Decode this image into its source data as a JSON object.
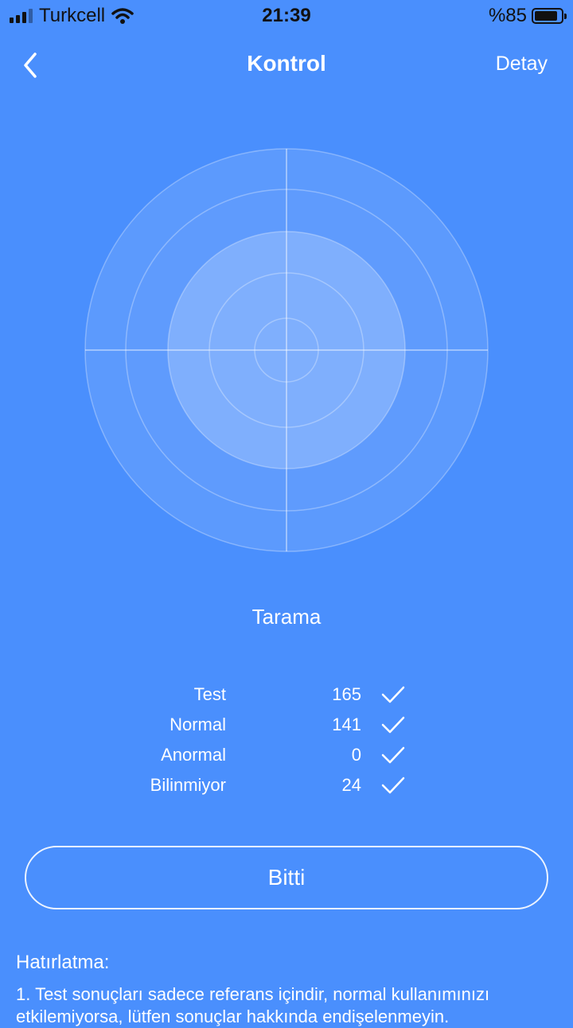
{
  "status_bar": {
    "carrier": "Turkcell",
    "time": "21:39",
    "battery": "%85",
    "icons": [
      "signal-icon",
      "wifi-icon",
      "battery-icon"
    ]
  },
  "nav": {
    "back_icon": "chevron-left-icon",
    "title": "Kontrol",
    "detail_label": "Detay"
  },
  "scan": {
    "label": "Tarama"
  },
  "stats": [
    {
      "label": "Test",
      "value": "165",
      "icon": "check-icon"
    },
    {
      "label": "Normal",
      "value": "141",
      "icon": "check-icon"
    },
    {
      "label": "Anormal",
      "value": "0",
      "icon": "check-icon"
    },
    {
      "label": "Bilinmiyor",
      "value": "24",
      "icon": "check-icon"
    }
  ],
  "done_button": {
    "label": "Bitti"
  },
  "reminder": {
    "title": "Hatırlatma:",
    "text": "1. Test sonuçları sadece referans içindir, normal kullanımınızı etkilemiyorsa, lütfen sonuçlar hakkında endişelenmeyin."
  },
  "colors": {
    "background": "#4a8ffd",
    "text": "#ffffff"
  }
}
